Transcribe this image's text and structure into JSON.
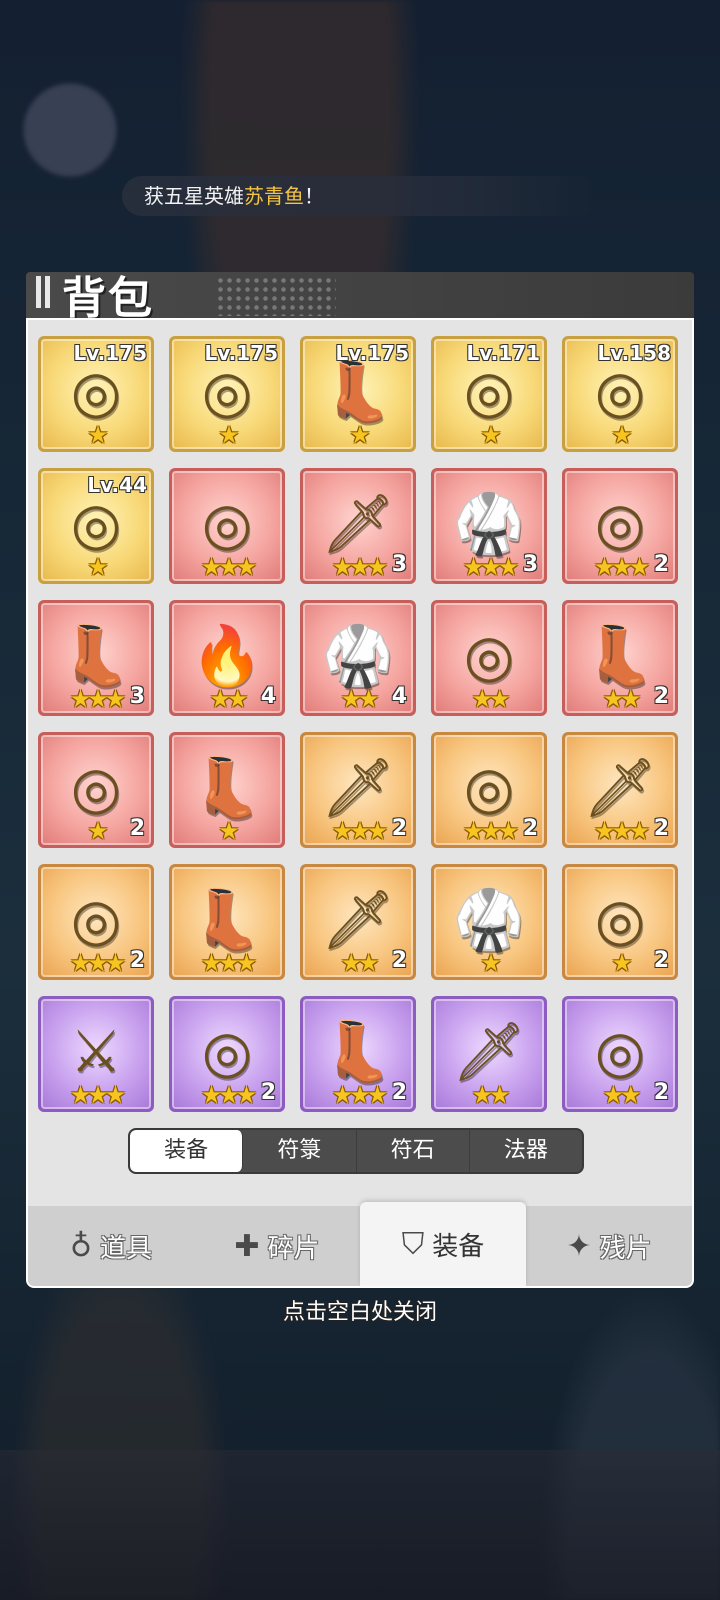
{
  "notice": {
    "prefix": "获五星英雄",
    "hero": "苏青鱼",
    "suffix": "！"
  },
  "title": "背包",
  "items": [
    {
      "rarity": "gold",
      "icon": "ring-icon",
      "glyph": "◎",
      "level": "Lv.175",
      "stars": "★",
      "count": ""
    },
    {
      "rarity": "gold",
      "icon": "ring-icon",
      "glyph": "◎",
      "level": "Lv.175",
      "stars": "★",
      "count": ""
    },
    {
      "rarity": "gold",
      "icon": "boots-icon",
      "glyph": "👢",
      "level": "Lv.175",
      "stars": "★",
      "count": ""
    },
    {
      "rarity": "gold",
      "icon": "ring-icon",
      "glyph": "◎",
      "level": "Lv.171",
      "stars": "★",
      "count": ""
    },
    {
      "rarity": "gold",
      "icon": "ring-icon",
      "glyph": "◎",
      "level": "Lv.158",
      "stars": "★",
      "count": ""
    },
    {
      "rarity": "gold",
      "icon": "ring-icon",
      "glyph": "◎",
      "level": "Lv.44",
      "stars": "★",
      "count": ""
    },
    {
      "rarity": "red",
      "icon": "ring-icon",
      "glyph": "◎",
      "level": "",
      "stars": "★★★",
      "count": ""
    },
    {
      "rarity": "red",
      "icon": "sword-icon",
      "glyph": "🗡",
      "level": "",
      "stars": "★★★",
      "count": "3"
    },
    {
      "rarity": "red",
      "icon": "armor-icon",
      "glyph": "🥋",
      "level": "",
      "stars": "★★★",
      "count": "3"
    },
    {
      "rarity": "red",
      "icon": "ring-icon",
      "glyph": "◎",
      "level": "",
      "stars": "★★★",
      "count": "2"
    },
    {
      "rarity": "red",
      "icon": "boots-icon",
      "glyph": "👢",
      "level": "",
      "stars": "★★★",
      "count": "3"
    },
    {
      "rarity": "red",
      "icon": "staff-icon",
      "glyph": "🔥",
      "level": "",
      "stars": "★★",
      "count": "4"
    },
    {
      "rarity": "red",
      "icon": "armor-icon",
      "glyph": "🥋",
      "level": "",
      "stars": "★★",
      "count": "4"
    },
    {
      "rarity": "red",
      "icon": "ring-icon",
      "glyph": "◎",
      "level": "",
      "stars": "★★",
      "count": ""
    },
    {
      "rarity": "red",
      "icon": "boots-icon",
      "glyph": "👢",
      "level": "",
      "stars": "★★",
      "count": "2"
    },
    {
      "rarity": "red",
      "icon": "ring-icon",
      "glyph": "◎",
      "level": "",
      "stars": "★",
      "count": "2"
    },
    {
      "rarity": "red",
      "icon": "boots-icon",
      "glyph": "👢",
      "level": "",
      "stars": "★",
      "count": ""
    },
    {
      "rarity": "orange",
      "icon": "sword-icon",
      "glyph": "🗡",
      "level": "",
      "stars": "★★★",
      "count": "2"
    },
    {
      "rarity": "orange",
      "icon": "ring-icon",
      "glyph": "◎",
      "level": "",
      "stars": "★★★",
      "count": "2"
    },
    {
      "rarity": "orange",
      "icon": "sword-icon",
      "glyph": "🗡",
      "level": "",
      "stars": "★★★",
      "count": "2"
    },
    {
      "rarity": "orange",
      "icon": "ring-icon",
      "glyph": "◎",
      "level": "",
      "stars": "★★★",
      "count": "2"
    },
    {
      "rarity": "orange",
      "icon": "boots-icon",
      "glyph": "👢",
      "level": "",
      "stars": "★★★",
      "count": ""
    },
    {
      "rarity": "orange",
      "icon": "sword-icon",
      "glyph": "🗡",
      "level": "",
      "stars": "★★",
      "count": "2"
    },
    {
      "rarity": "orange",
      "icon": "armor-icon",
      "glyph": "🥋",
      "level": "",
      "stars": "★",
      "count": ""
    },
    {
      "rarity": "orange",
      "icon": "ring-icon",
      "glyph": "◎",
      "level": "",
      "stars": "★",
      "count": "2"
    },
    {
      "rarity": "purple",
      "icon": "spear-icon",
      "glyph": "⚔",
      "level": "",
      "stars": "★★★",
      "count": ""
    },
    {
      "rarity": "purple",
      "icon": "ring-icon",
      "glyph": "◎",
      "level": "",
      "stars": "★★★",
      "count": "2"
    },
    {
      "rarity": "purple",
      "icon": "boots-icon",
      "glyph": "👢",
      "level": "",
      "stars": "★★★",
      "count": "2"
    },
    {
      "rarity": "purple",
      "icon": "dagger-icon",
      "glyph": "🗡",
      "level": "",
      "stars": "★★",
      "count": ""
    },
    {
      "rarity": "purple",
      "icon": "ring-icon",
      "glyph": "◎",
      "level": "",
      "stars": "★★",
      "count": "2"
    }
  ],
  "sub_tabs": [
    {
      "label": "装备",
      "active": true
    },
    {
      "label": "符箓",
      "active": false
    },
    {
      "label": "符石",
      "active": false
    },
    {
      "label": "法器",
      "active": false
    }
  ],
  "main_tabs": [
    {
      "label": "道具",
      "icon": "potion-icon",
      "glyph": "♁",
      "active": false
    },
    {
      "label": "碎片",
      "icon": "puzzle-icon",
      "glyph": "✚",
      "active": false
    },
    {
      "label": "装备",
      "icon": "shield-icon",
      "glyph": "⛉",
      "active": true
    },
    {
      "label": "残片",
      "icon": "shard-icon",
      "glyph": "✦",
      "active": false
    }
  ],
  "close_hint": "点击空白处关闭"
}
